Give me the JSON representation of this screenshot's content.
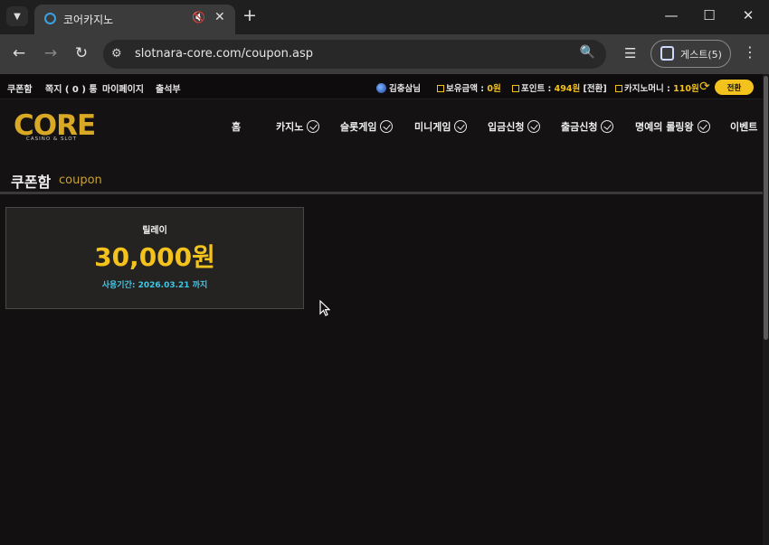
{
  "browser": {
    "tab_title": "코어카지노",
    "url": "slotnara-core.com/coupon.asp",
    "guest_label": "게스트(5)",
    "icons": {
      "tab_list": "chevron-down-icon",
      "favicon": "loading-circle-icon",
      "mute": "muted-speaker-icon",
      "close_tab": "close-icon",
      "new_tab": "plus-icon",
      "back": "arrow-left-icon",
      "forward": "arrow-right-icon",
      "reload": "reload-icon",
      "site_info": "tune-icon",
      "zoom": "magnifier-icon",
      "reading_list": "reading-list-icon",
      "profile": "person-icon",
      "menu": "kebab-icon"
    }
  },
  "topbar": {
    "links": [
      "쿠폰함",
      "쪽지 ( 0 ) 통",
      "마이페이지",
      "출석부"
    ],
    "username": "김충삼님",
    "balance_label": "보유금액 : ",
    "balance_value": "0원",
    "point_label": "포인트 : ",
    "point_value": "494원",
    "point_suffix": " [전환]",
    "casino_label": "카지노머니 : ",
    "casino_value": "110원",
    "convert_button": "전환"
  },
  "logo": {
    "text": "CORE",
    "subtitle": "CASINO & SLOT"
  },
  "nav": [
    "홈",
    "카지노",
    "슬롯게임",
    "미니게임",
    "입금신청",
    "출금신청",
    "명예의 롤링왕",
    "이벤트"
  ],
  "page_title": {
    "korean": "쿠폰함",
    "english": "coupon"
  },
  "coupon": {
    "name": "릴레이",
    "amount": "30,000원",
    "expiry": "사용기간: 2026.03.21 까지"
  },
  "colors": {
    "accent": "#f3c21c",
    "expiry": "#3cc8e8",
    "background": "#121011"
  }
}
